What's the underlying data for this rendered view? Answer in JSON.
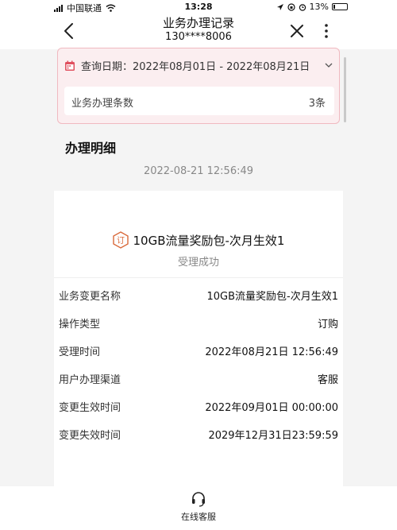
{
  "status_bar": {
    "carrier": "中国联通",
    "time": "13:28",
    "battery": "13%",
    "battery_level": 0.13,
    "icons": [
      "signal-icon",
      "wifi-icon",
      "location-icon",
      "lock-rotation-icon",
      "alarm-icon",
      "battery-icon"
    ]
  },
  "nav": {
    "title": "业务办理记录",
    "subtitle": "130****8006",
    "icons": [
      "back-arrow-icon",
      "close-icon",
      "more-icon"
    ]
  },
  "query": {
    "date_label": "查询日期：",
    "date_range": "2022年08月01日 - 2022年08月21日",
    "count_label": "业务办理条数",
    "count_value": "3条"
  },
  "section_title": "办理明细",
  "record": {
    "time": "2022-08-21 12:56:49",
    "package_name": "10GB流量奖励包-次月生效1",
    "status": "受理成功",
    "details": [
      {
        "label": "业务变更名称",
        "value": "10GB流量奖励包-次月生效1"
      },
      {
        "label": "操作类型",
        "value": "订购"
      },
      {
        "label": "受理时间",
        "value": "2022年08月21日 12:56:49"
      },
      {
        "label": "用户办理渠道",
        "value": "客服"
      },
      {
        "label": "变更生效时间",
        "value": "2022年09月01日 00:00:00"
      },
      {
        "label": "变更失效时间",
        "value": "2029年12月31日23:59:59"
      }
    ]
  },
  "bottom": {
    "service_label": "在线客服"
  },
  "colors": {
    "accent": "#e0505f",
    "order_icon": "#d9693a",
    "card_bg": "#fbeef0"
  }
}
